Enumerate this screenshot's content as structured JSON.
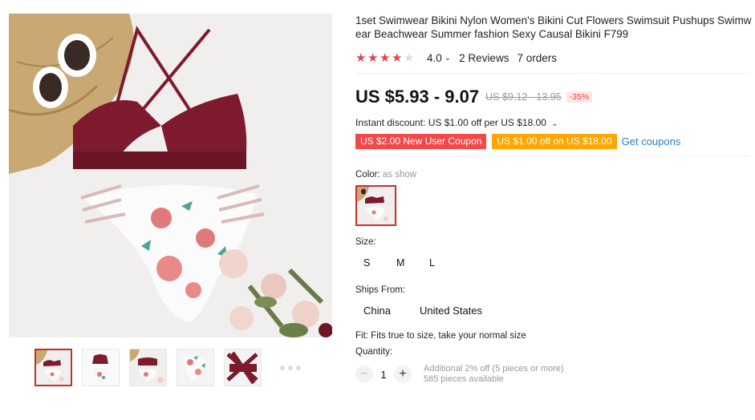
{
  "product": {
    "title": "1set Swimwear Bikini Nylon Women's Bikini Cut Flowers Swimsuit Pushups Swimwear Beachwear Summer fashion Sexy Causal Bikini F799",
    "rating": "4.0",
    "rating_stars": 4,
    "reviews": "2 Reviews",
    "orders": "7 orders"
  },
  "price": {
    "current": "US $5.93 - 9.07",
    "original": "US $9.12 - 13.95",
    "discount": "-35%"
  },
  "promo": {
    "instant_discount": "Instant discount: US $1.00 off per US $18.00",
    "coupon_new_user": "US $2.00 New User Coupon",
    "coupon_store": "US $1.00 off on US $18.00",
    "get_coupons": "Get coupons"
  },
  "options": {
    "color_label": "Color:",
    "color_value": "as show",
    "size_label": "Size:",
    "sizes": [
      "S",
      "M",
      "L"
    ],
    "ships_label": "Ships From:",
    "ships_from": [
      "China",
      "United States"
    ]
  },
  "fit": "Fit: Fits true to size, take your normal size",
  "quantity": {
    "label": "Quantity:",
    "value": "1",
    "minus": "−",
    "plus": "+",
    "additional": "Additional 2% off (5 pieces or more)",
    "available": "585 pieces available"
  },
  "colors": {
    "accent_red": "#e8414a",
    "coupon_red": "#f44848",
    "coupon_orange": "#ffa600",
    "link_blue": "#2b7fc3",
    "burgundy": "#7d1a2e"
  },
  "icons": {
    "star": "star-icon",
    "caret": "chevron-down-icon",
    "minus": "minus-icon",
    "plus": "plus-icon"
  }
}
